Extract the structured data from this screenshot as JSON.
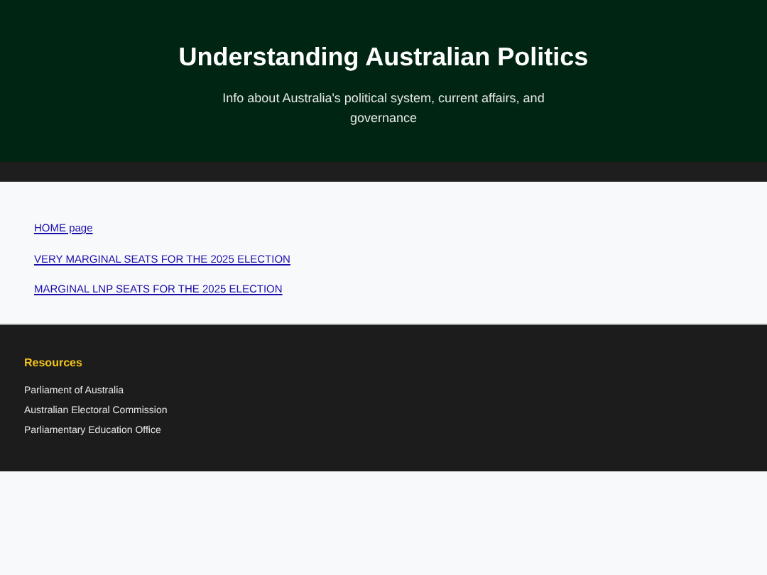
{
  "header": {
    "title": "Understanding Australian Politics",
    "subtitle": "Info about Australia's political system, current affairs, and governance"
  },
  "links": [
    "HOME page",
    "VERY MARGINAL SEATS FOR THE 2025 ELECTION",
    "MARGINAL LNP SEATS FOR THE 2025 ELECTION"
  ],
  "footer": {
    "heading": "Resources",
    "items": [
      "Parliament of Australia",
      "Australian Electoral Commission",
      "Parliamentary Education Office"
    ]
  }
}
